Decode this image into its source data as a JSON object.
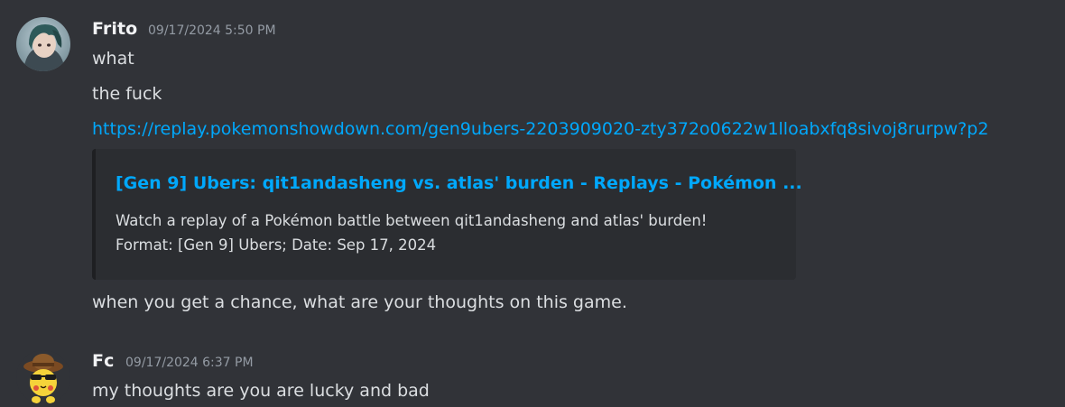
{
  "messages": [
    {
      "username": "Frito",
      "timestamp": "09/17/2024 5:50 PM",
      "lines": [
        "what",
        "the fuck"
      ],
      "link": "https://replay.pokemonshowdown.com/gen9ubers-2203909020-zty372o0622w1lloabxfq8sivoj8rurpw?p2",
      "embed": {
        "title": "[Gen 9] Ubers: qit1andasheng vs. atlas' burden - Replays - Pokémon ...",
        "description_line1": "Watch a replay of a Pokémon battle between qit1andasheng and atlas' burden!",
        "description_line2": "Format: [Gen 9] Ubers; Date: Sep 17, 2024"
      },
      "after_embed": "when you get a chance, what are your thoughts on this game."
    },
    {
      "username": "Fc",
      "timestamp": "09/17/2024 6:37 PM",
      "lines": [
        "my thoughts are you are lucky and bad"
      ]
    }
  ],
  "colors": {
    "background": "#313338",
    "link": "#00a8fc",
    "text": "#dbdee1",
    "muted": "#949ba4",
    "embed_bg": "#2b2d31"
  }
}
